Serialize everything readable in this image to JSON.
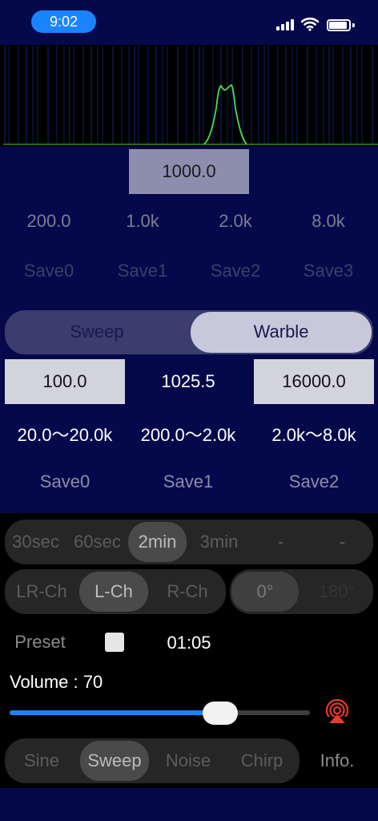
{
  "status": {
    "time": "9:02"
  },
  "tone": {
    "frequency": "1000.0",
    "presets": [
      "200.0",
      "1.0k",
      "2.0k",
      "8.0k"
    ],
    "saves": [
      "Save0",
      "Save1",
      "Save2",
      "Save3"
    ]
  },
  "mode": {
    "options": [
      "Sweep",
      "Warble"
    ],
    "selected": "Warble"
  },
  "range": {
    "start": "100.0",
    "current": "1025.5",
    "end": "16000.0",
    "presets": [
      "20.0〜20.0k",
      "200.0〜2.0k",
      "2.0k〜8.0k"
    ],
    "saves": [
      "Save0",
      "Save1",
      "Save2"
    ]
  },
  "duration": {
    "options": [
      "30sec",
      "60sec",
      "2min",
      "3min",
      "-",
      "-"
    ],
    "selected": "2min"
  },
  "channel": {
    "options": [
      "LR-Ch",
      "L-Ch",
      "R-Ch"
    ],
    "selected": "L-Ch"
  },
  "phase": {
    "options": [
      "0°",
      "180°"
    ],
    "selected": "0°"
  },
  "preset": {
    "label": "Preset",
    "checked": false,
    "elapsed": "01:05"
  },
  "volume": {
    "label": "Volume : 70",
    "value": 70,
    "max": 100
  },
  "waveform": {
    "options": [
      "Sine",
      "Sweep",
      "Noise",
      "Chirp"
    ],
    "selected": "Sweep"
  },
  "info_label": "Info.",
  "colors": {
    "accent": "#1a84ff",
    "spectrum": "#4fe04f",
    "navy": "#05094b",
    "airplay": "#e8392f"
  },
  "icons": [
    "signal-icon",
    "wifi-icon",
    "battery-icon",
    "airplay-icon"
  ]
}
